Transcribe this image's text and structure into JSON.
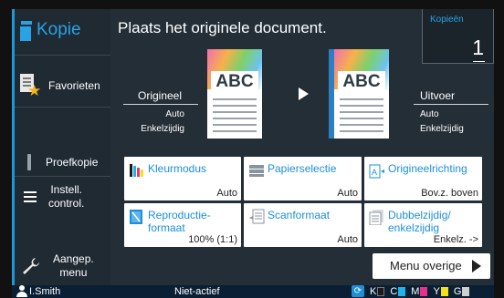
{
  "sidebar": {
    "title": "Kopie",
    "favorites_label": "Favorieten",
    "proof_label": "Proefkopie",
    "settings_label": "Instell.\ncontrol.",
    "custom_menu_label": "Aangep.\nmenu"
  },
  "header": {
    "message": "Plaats het originele document.",
    "copies_label": "Kopieën",
    "copies_value": "1"
  },
  "preview": {
    "paper_text": "ABC",
    "original_title": "Origineel",
    "original_line1": "Auto",
    "original_line2": "Enkelzijdig",
    "output_title": "Uitvoer",
    "output_line1": "Auto",
    "output_line2": "Enkelzijdig"
  },
  "buttons": {
    "color_mode": {
      "label": "Kleurmodus",
      "value": "Auto"
    },
    "paper_select": {
      "label": "Papierselectie",
      "value": "Auto"
    },
    "orientation": {
      "label": "Origineelrichting",
      "value": "Bov.z. boven"
    },
    "reproduction": {
      "label": "Reproductie-\nformaat",
      "value": "100% (1:1)"
    },
    "scan_format": {
      "label": "Scanformaat",
      "value": "Auto"
    },
    "duplex": {
      "label": "Dubbelzijdig/\nenkelzijdig",
      "value": "Enkelz. ->"
    },
    "more_menu": "Menu overige"
  },
  "status": {
    "user": "I.Smith",
    "state": "Niet-actief",
    "toner": [
      {
        "letter": "K",
        "color": "#1a1a1a"
      },
      {
        "letter": "C",
        "color": "#1fb3e8"
      },
      {
        "letter": "M",
        "color": "#e6308a"
      },
      {
        "letter": "Y",
        "color": "#f3e21b"
      },
      {
        "letter": "G",
        "color": "#cfcfcf"
      }
    ]
  },
  "colors": {
    "accent": "#1e96d8",
    "sidebar_bg": "#202a33",
    "main_bg": "#232e37"
  }
}
